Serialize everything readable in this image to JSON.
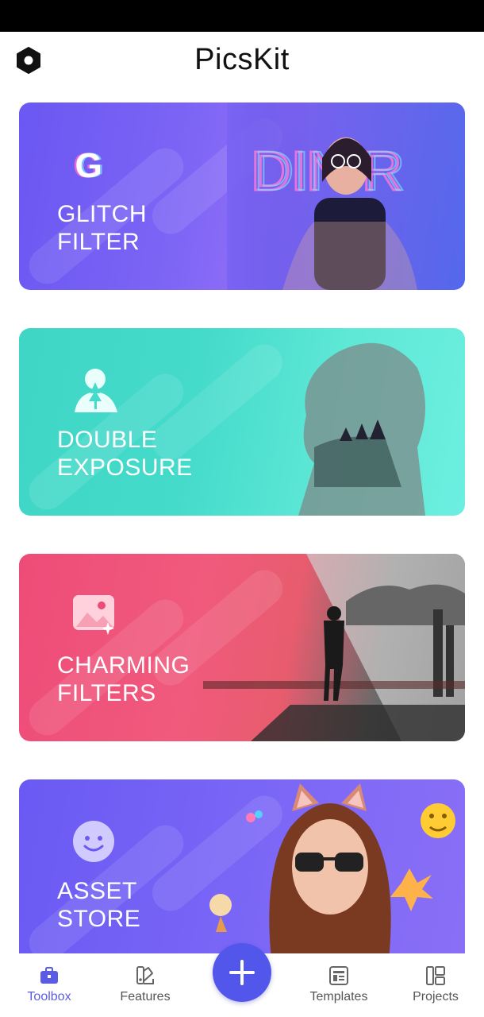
{
  "app": {
    "title": "PicsKit"
  },
  "header": {
    "settings_icon": "hexagon-settings-icon"
  },
  "cards": [
    {
      "label": "GLITCH\nFILTER",
      "icon": "glitch-g-icon"
    },
    {
      "label": "DOUBLE\nEXPOSURE",
      "icon": "person-tree-icon"
    },
    {
      "label": "CHARMING\nFILTERS",
      "icon": "image-sparkle-icon"
    },
    {
      "label": "ASSET\nSTORE",
      "icon": "smiley-icon"
    }
  ],
  "bottom_nav": {
    "items": [
      {
        "label": "Toolbox",
        "icon": "toolbox-icon",
        "active": true
      },
      {
        "label": "Features",
        "icon": "swatches-icon",
        "active": false
      },
      {
        "label": "Templates",
        "icon": "template-icon",
        "active": false
      },
      {
        "label": "Projects",
        "icon": "projects-icon",
        "active": false
      }
    ],
    "fab_icon": "plus-icon"
  },
  "colors": {
    "accent": "#5356ea",
    "glitch_card": "#7b64f5",
    "double_card": "#45dbcb",
    "charm_card": "#ee4c78",
    "asset_card": "#7a66f6"
  }
}
